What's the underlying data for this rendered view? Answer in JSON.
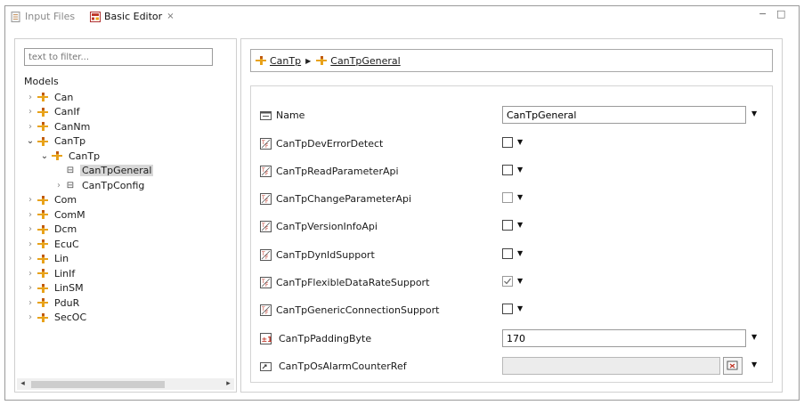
{
  "tabs": [
    {
      "label": "Input Files",
      "active": false
    },
    {
      "label": "Basic Editor",
      "active": true,
      "close": "⨯"
    }
  ],
  "window_controls": {
    "minimize": "−",
    "maximize": "□"
  },
  "left": {
    "filter_placeholder": "text to filter...",
    "models_label": "Models",
    "tree": [
      {
        "label": "Can",
        "level": 0,
        "expanded": false
      },
      {
        "label": "CanIf",
        "level": 0,
        "expanded": false
      },
      {
        "label": "CanNm",
        "level": 0,
        "expanded": false
      },
      {
        "label": "CanTp",
        "level": 0,
        "expanded": true
      },
      {
        "label": "CanTp",
        "level": 1,
        "expanded": true
      },
      {
        "label": "CanTpGeneral",
        "level": 2,
        "selected": true
      },
      {
        "label": "CanTpConfig",
        "level": 2,
        "expanded": false
      },
      {
        "label": "Com",
        "level": 0,
        "expanded": false
      },
      {
        "label": "ComM",
        "level": 0,
        "expanded": false
      },
      {
        "label": "Dcm",
        "level": 0,
        "expanded": false
      },
      {
        "label": "EcuC",
        "level": 0,
        "expanded": false
      },
      {
        "label": "Lin",
        "level": 0,
        "expanded": false
      },
      {
        "label": "LinIf",
        "level": 0,
        "expanded": false
      },
      {
        "label": "LinSM",
        "level": 0,
        "expanded": false
      },
      {
        "label": "PduR",
        "level": 0,
        "expanded": false
      },
      {
        "label": "SecOC",
        "level": 0,
        "expanded": false
      }
    ]
  },
  "breadcrumb": {
    "items": [
      "CanTp",
      "CanTpGeneral"
    ]
  },
  "form": {
    "name": {
      "label": "Name",
      "value": "CanTpGeneral"
    },
    "booleans": [
      {
        "label": "CanTpDevErrorDetect",
        "checked": false
      },
      {
        "label": "CanTpReadParameterApi",
        "checked": false
      },
      {
        "label": "CanTpChangeParameterApi",
        "checked": false
      },
      {
        "label": "CanTpVersionInfoApi",
        "checked": false
      },
      {
        "label": "CanTpDynIdSupport",
        "checked": false
      },
      {
        "label": "CanTpFlexibleDataRateSupport",
        "checked": true
      },
      {
        "label": "CanTpGenericConnectionSupport",
        "checked": false
      }
    ],
    "padding_byte": {
      "label": "CanTpPaddingByte",
      "value": "170"
    },
    "alarm_ref": {
      "label": "CanTpOsAlarmCounterRef",
      "value": ""
    }
  },
  "colors": {
    "module_icon": "#e8a21a",
    "module_icon_dark": "#c05a10",
    "boolean_icon": "#c0392b"
  }
}
